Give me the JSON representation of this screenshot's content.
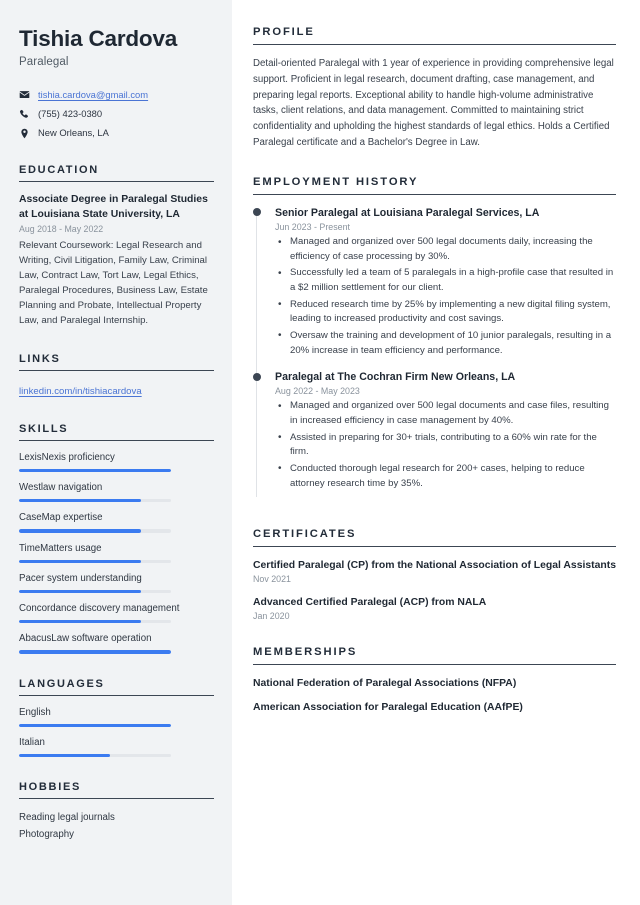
{
  "theme": {
    "sidebar_bg": "#f1f3f5",
    "page_bg": "#ffffff",
    "heading_color": "#222c39",
    "accent_blue": "#3b7bf0",
    "link_blue": "#4a74d4",
    "muted_text": "#8a939d",
    "body_text": "#39414c"
  },
  "header": {
    "name": "Tishia Cardova",
    "job_title": "Paralegal",
    "contacts": [
      {
        "icon": "envelope-icon",
        "text": "tishia.cardova@gmail.com",
        "is_link": true
      },
      {
        "icon": "phone-icon",
        "text": "(755) 423-0380",
        "is_link": false
      },
      {
        "icon": "location-pin-icon",
        "text": "New Orleans, LA",
        "is_link": false
      }
    ]
  },
  "sidebar": {
    "education": {
      "heading": "EDUCATION",
      "items": [
        {
          "title": "Associate Degree in Paralegal Studies at Louisiana State University, LA",
          "date": "Aug 2018 - May 2022",
          "description": "Relevant Coursework: Legal Research and Writing, Civil Litigation, Family Law, Criminal Law, Contract Law, Tort Law, Legal Ethics, Paralegal Procedures, Business Law, Estate Planning and Probate, Intellectual Property Law, and Paralegal Internship."
        }
      ]
    },
    "links": {
      "heading": "LINKS",
      "items": [
        {
          "label": "linkedin.com/in/tishiacardova"
        }
      ]
    },
    "skills": {
      "heading": "SKILLS",
      "items": [
        {
          "label": "LexisNexis proficiency",
          "level": 100
        },
        {
          "label": "Westlaw navigation",
          "level": 80
        },
        {
          "label": "CaseMap expertise",
          "level": 80
        },
        {
          "label": "TimeMatters usage",
          "level": 80
        },
        {
          "label": "Pacer system understanding",
          "level": 80
        },
        {
          "label": "Concordance discovery management",
          "level": 80
        },
        {
          "label": "AbacusLaw software operation",
          "level": 100
        }
      ]
    },
    "languages": {
      "heading": "LANGUAGES",
      "items": [
        {
          "label": "English",
          "level": 100
        },
        {
          "label": "Italian",
          "level": 60
        }
      ]
    },
    "hobbies": {
      "heading": "HOBBIES",
      "items": [
        {
          "label": "Reading legal journals"
        },
        {
          "label": "Photography"
        }
      ]
    }
  },
  "main": {
    "profile": {
      "heading": "PROFILE",
      "text": "Detail-oriented Paralegal with 1 year of experience in providing comprehensive legal support. Proficient in legal research, document drafting, case management, and preparing legal reports. Exceptional ability to handle high-volume administrative tasks, client relations, and data management. Committed to maintaining strict confidentiality and upholding the highest standards of legal ethics. Holds a Certified Paralegal certificate and a Bachelor's Degree in Law."
    },
    "employment": {
      "heading": "EMPLOYMENT HISTORY",
      "items": [
        {
          "title": "Senior Paralegal at Louisiana Paralegal Services, LA",
          "date": "Jun 2023 - Present",
          "bullets": [
            "Managed and organized over 500 legal documents daily, increasing the efficiency of case processing by 30%.",
            "Successfully led a team of 5 paralegals in a high-profile case that resulted in a $2 million settlement for our client.",
            "Reduced research time by 25% by implementing a new digital filing system, leading to increased productivity and cost savings.",
            "Oversaw the training and development of 10 junior paralegals, resulting in a 20% increase in team efficiency and performance."
          ]
        },
        {
          "title": "Paralegal at The Cochran Firm New Orleans, LA",
          "date": "Aug 2022 - May 2023",
          "bullets": [
            "Managed and organized over 500 legal documents and case files, resulting in increased efficiency in case management by 40%.",
            "Assisted in preparing for 30+ trials, contributing to a 60% win rate for the firm.",
            "Conducted thorough legal research for 200+ cases, helping to reduce attorney research time by 35%."
          ]
        }
      ]
    },
    "certificates": {
      "heading": "CERTIFICATES",
      "items": [
        {
          "name": "Certified Paralegal (CP) from the National Association of Legal Assistants",
          "date": "Nov 2021"
        },
        {
          "name": "Advanced Certified Paralegal (ACP) from NALA",
          "date": "Jan 2020"
        }
      ]
    },
    "memberships": {
      "heading": "MEMBERSHIPS",
      "items": [
        {
          "name": "National Federation of Paralegal Associations (NFPA)"
        },
        {
          "name": "American Association for Paralegal Education (AAfPE)"
        }
      ]
    }
  }
}
